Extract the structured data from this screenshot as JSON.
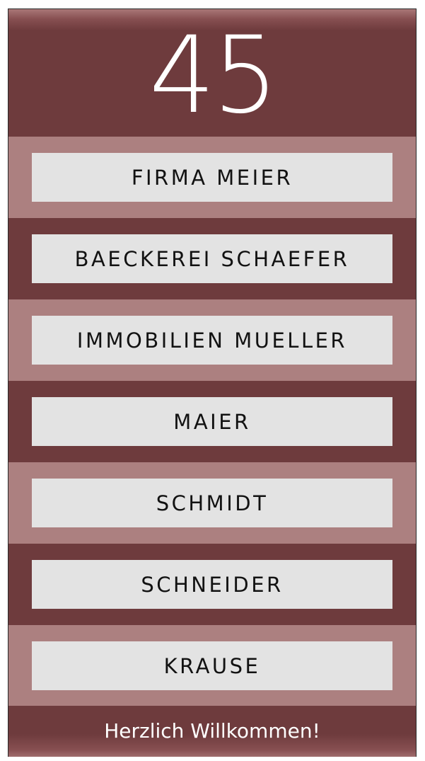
{
  "header": {
    "counter": "45"
  },
  "entries": [
    {
      "label": "FIRMA MEIER"
    },
    {
      "label": "BAECKEREI SCHAEFER"
    },
    {
      "label": "IMMOBILIEN MUELLER"
    },
    {
      "label": "MAIER"
    },
    {
      "label": "SCHMIDT"
    },
    {
      "label": "SCHNEIDER"
    },
    {
      "label": "KRAUSE"
    }
  ],
  "footer": {
    "welcome": "Herzlich Willkommen!"
  },
  "colors": {
    "dark_band": "#6e3b3d",
    "light_band": "#ac8080",
    "button_bg": "#e3e3e3",
    "text_dark": "#121212",
    "text_light": "#ffffff"
  }
}
